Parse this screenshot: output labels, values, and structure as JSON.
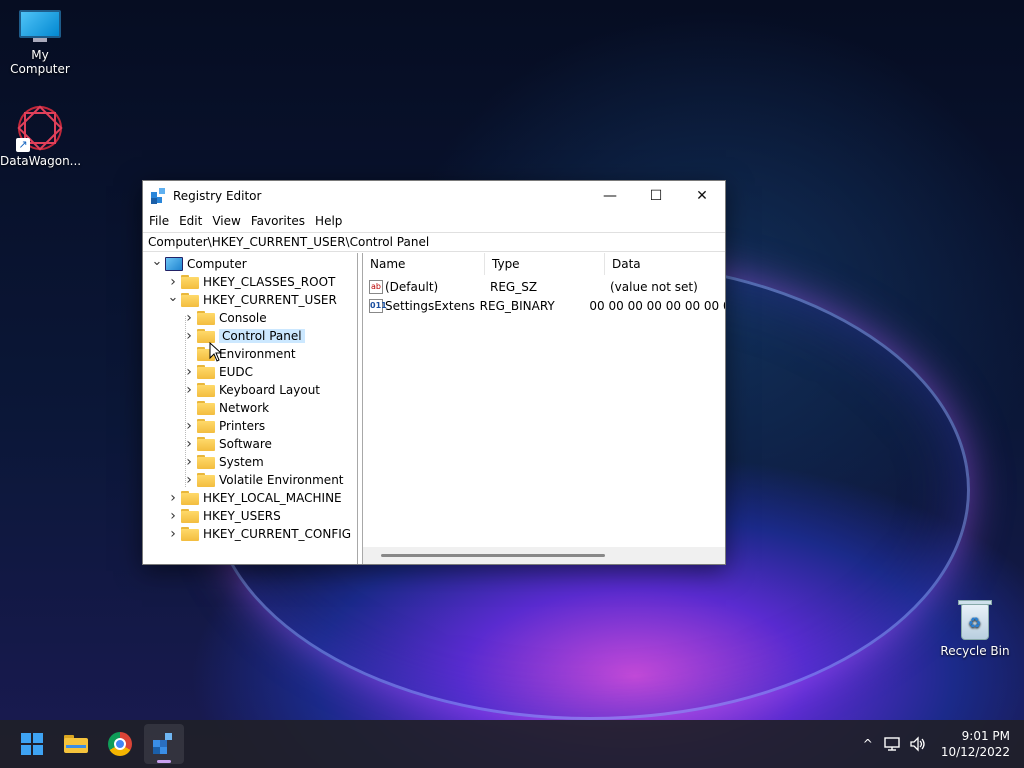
{
  "desktop": {
    "icons": [
      {
        "label": "My Computer"
      },
      {
        "label": "DataWagon..."
      },
      {
        "label": "Recycle Bin"
      }
    ]
  },
  "window": {
    "title": "Registry Editor",
    "controls": {
      "minimize": "—",
      "maximize": "☐",
      "close": "✕"
    },
    "menu": [
      "File",
      "Edit",
      "View",
      "Favorites",
      "Help"
    ],
    "address": "Computer\\HKEY_CURRENT_USER\\Control Panel",
    "tree": [
      {
        "label": "Computer",
        "level": 0,
        "expanded": true,
        "icon": "computer-icon"
      },
      {
        "label": "HKEY_CLASSES_ROOT",
        "level": 1,
        "expanded": false
      },
      {
        "label": "HKEY_CURRENT_USER",
        "level": 1,
        "expanded": true
      },
      {
        "label": "Console",
        "level": 2,
        "expanded": false
      },
      {
        "label": "Control Panel",
        "level": 2,
        "expanded": false,
        "selected": true
      },
      {
        "label": "Environment",
        "level": 2,
        "noexpander": true
      },
      {
        "label": "EUDC",
        "level": 2,
        "expanded": false
      },
      {
        "label": "Keyboard Layout",
        "level": 2,
        "expanded": false
      },
      {
        "label": "Network",
        "level": 2,
        "noexpander": true
      },
      {
        "label": "Printers",
        "level": 2,
        "expanded": false
      },
      {
        "label": "Software",
        "level": 2,
        "expanded": false
      },
      {
        "label": "System",
        "level": 2,
        "expanded": false
      },
      {
        "label": "Volatile Environment",
        "level": 2,
        "expanded": false
      },
      {
        "label": "HKEY_LOCAL_MACHINE",
        "level": 1,
        "expanded": false
      },
      {
        "label": "HKEY_USERS",
        "level": 1,
        "expanded": false
      },
      {
        "label": "HKEY_CURRENT_CONFIG",
        "level": 1,
        "expanded": false
      }
    ],
    "columns": [
      "Name",
      "Type",
      "Data"
    ],
    "values": [
      {
        "icon": "ab",
        "name": "(Default)",
        "type": "REG_SZ",
        "data": "(value not set)"
      },
      {
        "icon": "011",
        "name": "SettingsExtensio...",
        "type": "REG_BINARY",
        "data": "00 00 00 00 00 00 00 00"
      }
    ]
  },
  "taskbar": {
    "time": "9:01 PM",
    "date": "10/12/2022",
    "tray_chevron": "^"
  }
}
